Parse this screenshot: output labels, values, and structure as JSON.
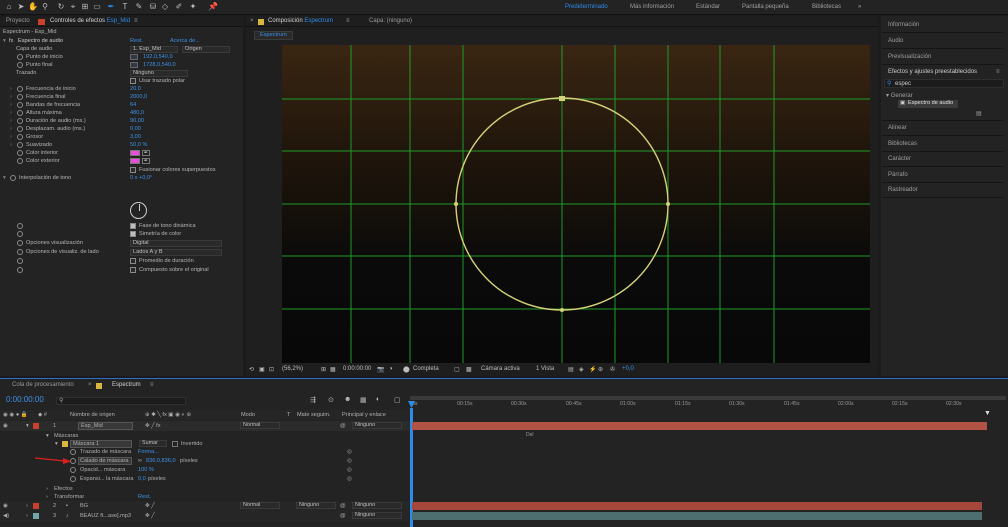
{
  "workspaces": {
    "predeterminado": "Predeterminado",
    "mas_informacion": "Más información",
    "estandar": "Estándar",
    "pantalla_pequena": "Pantalla pequeña",
    "bibliotecas": "Bibliotecas"
  },
  "left_tabs": {
    "proyecto": "Proyecto",
    "controles_prefix": "Controles de efectos",
    "controles_layer": "Esp_Mid"
  },
  "effect_controls": {
    "header": "Espectrum - Esp_Mid",
    "effect_name": "Espectro de audio",
    "reset": "Rest.",
    "about": "Acerca de...",
    "rows": [
      {
        "label": "Capa de audio",
        "value": "1. Esp_Mid",
        "extra": "Origen"
      },
      {
        "label": "Punto de inicio",
        "value": "192,0,540,0"
      },
      {
        "label": "Punto final",
        "value": "1728,0,540,0"
      },
      {
        "label": "Trazado",
        "value": "Ninguno"
      },
      {
        "label": "",
        "value": "Usar trazado polar"
      },
      {
        "label": "Frecuencia de inicio",
        "value": "20,0"
      },
      {
        "label": "Frecuencia final",
        "value": "2000,0"
      },
      {
        "label": "Bandas de frecuencia",
        "value": "64"
      },
      {
        "label": "Altura máxima",
        "value": "480,0"
      },
      {
        "label": "Duración de audio (ms.)",
        "value": "90,00"
      },
      {
        "label": "Desplazam. audio (ms.)",
        "value": "0,00"
      },
      {
        "label": "Grosor",
        "value": "3,00"
      },
      {
        "label": "Suavizado",
        "value": "50,0 %"
      },
      {
        "label": "Color interior",
        "value": ""
      },
      {
        "label": "Color exterior",
        "value": ""
      },
      {
        "label": "",
        "value": "Fusionar colores superpuestos"
      },
      {
        "label": "Interpolación de tono",
        "value": "0 x +0,0°"
      },
      {
        "label": "",
        "value": "Fase de tono dinámica"
      },
      {
        "label": "",
        "value": "Simetría de color"
      },
      {
        "label": "Opciones visualización",
        "value": "Digital"
      },
      {
        "label": "Opciones de visualiz. de lado",
        "value": "Lados A y B"
      },
      {
        "label": "",
        "value": "Promedio de duración"
      },
      {
        "label": "",
        "value": "Compuesto sobre el original"
      }
    ]
  },
  "comp_tabs": {
    "composicion_prefix": "Composición",
    "composicion_name": "Espectrum",
    "capa": "Capa: (ninguno)",
    "breadcrumb": "Espectrum"
  },
  "viewer_bar": {
    "zoom": "(56,2%)",
    "timecode": "0:00:00:00",
    "quality": "Completa",
    "camera": "Cámara activa",
    "views": "1 Vista",
    "exposure": "+0,0"
  },
  "right_panel": {
    "informacion": "Información",
    "audio": "Audio",
    "previsualizacion": "Previsualización",
    "efectos": "Efectos y ajustes preestablecidos",
    "search": "espec",
    "generar": "Generar",
    "result": "Espectro de audio",
    "alinear": "Alinear",
    "bibliotecas": "Bibliotecas",
    "caracter": "Carácter",
    "parrafo": "Párrafo",
    "rastreador": "Rastreador"
  },
  "timeline": {
    "tab_cola": "Cola de procesamiento",
    "tab_comp": "Espectrum",
    "timecode": "0:00:00:00",
    "col_source": "Nombre de origen",
    "col_mode": "Modo",
    "col_t": "T",
    "col_track": "Mate seguim.",
    "col_parent": "Principal y enlace",
    "layers": [
      {
        "num": "1",
        "name": "Esp_Mid",
        "mode": "Normal",
        "parent": "Ninguno"
      },
      {
        "num": "2",
        "name": "BG",
        "mode": "Normal",
        "track": "Ninguno",
        "parent": "Ninguno"
      },
      {
        "num": "3",
        "name": "BEAUZ ft...ase].mp3",
        "parent": "Ninguno"
      }
    ],
    "mascaras": "Máscaras",
    "mascara1": "Máscara 1",
    "sumar": "Sumar",
    "invertido": "Invertido",
    "trazado": "Trazado de máscara",
    "trazado_val": "Forma...",
    "calado": "Calado de máscara",
    "calado_val": "836,0,836,0",
    "calado_unit": "píxeles",
    "opacidad": "Opacid... máscara",
    "opacidad_val": "100 %",
    "expansion": "Expansi... la máscara",
    "expansion_val": "0,0",
    "expansion_unit": "píxeles",
    "efectos": "Efectos",
    "transformar": "Transformar",
    "transformar_val": "Rest.",
    "ruler": [
      "0s",
      "00:15s",
      "00:30s",
      "00:45s",
      "01:00s",
      "01:15s",
      "01:30s",
      "01:45s",
      "02:00s",
      "02:15s",
      "02:30s"
    ],
    "layer_bar_label": "Del"
  },
  "colors": {
    "accent": "#2d8ceb",
    "layer1_bar": "#b25445",
    "layer2_bar": "#a6473b",
    "layer3_bar": "#4e6f70",
    "grid": "#1e9a2a",
    "circle": "#d6d27a",
    "spectrum_color": "#e84ddb",
    "annotation_arrow": "#e02020"
  }
}
